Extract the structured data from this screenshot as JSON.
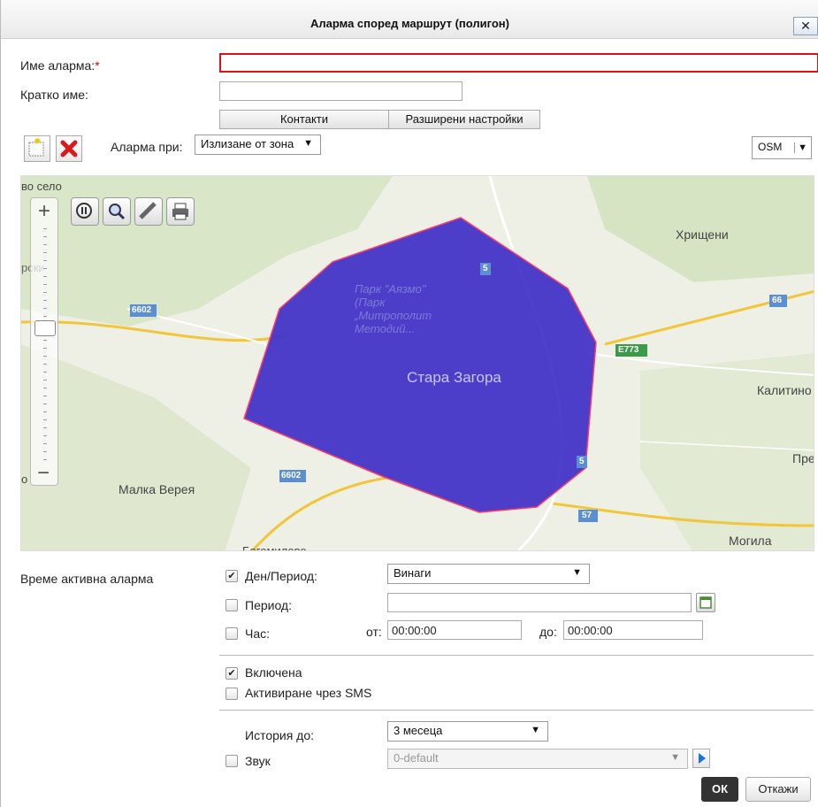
{
  "dialog": {
    "title": "Аларма според маршрут (полигон)",
    "close_label": "✕"
  },
  "form": {
    "name_label": "Име аларма:",
    "required_mark": "*",
    "name_value": "",
    "short_name_label": "Кратко име:",
    "short_name_value": "",
    "contacts_button": "Контакти",
    "advanced_button": "Разширени настройки",
    "alarm_on_label": "Аларма при:",
    "alarm_on_value": "Излизане от зона",
    "map_layer": "OSM"
  },
  "map": {
    "labels": {
      "park": "Парк \"Аязмо\"\n(Парк\n„Митрополит\nМетодий...",
      "city": "Стара Загора",
      "hristeni": "Хрищени",
      "kalitinovo": "Калитино",
      "preslaven": "Пре",
      "malka_vereya": "Малка Верея",
      "mogila": "Могила",
      "top_left": "во село",
      "left_mid": "рски",
      "left_low": "о",
      "bottom": "Богомилово",
      "road_6602_a": "6602",
      "road_6602_b": "6602",
      "road_5_a": "5",
      "road_5_b": "5",
      "road_66": "66",
      "road_e773": "E773",
      "road_57": "57"
    },
    "polygon_color": "#3f2fc8"
  },
  "schedule": {
    "section_label": "Време активна аларма",
    "day_period_label": "Ден/Период:",
    "day_period_checked": true,
    "day_period_value": "Винаги",
    "period_label": "Период:",
    "period_checked": false,
    "period_value": "",
    "hour_label": "Час:",
    "hour_checked": false,
    "from_label": "от:",
    "from_value": "00:00:00",
    "to_label": "до:",
    "to_value": "00:00:00"
  },
  "options": {
    "enabled_label": "Включена",
    "enabled_checked": true,
    "sms_label": "Активиране чрез SMS",
    "sms_checked": false
  },
  "history": {
    "label": "История до:",
    "value": "3 месеца",
    "sound_label": "Звук",
    "sound_checked": false,
    "sound_value": "0-default"
  },
  "actions": {
    "ok": "ОК",
    "cancel": "Откажи"
  },
  "checkmark": "✔"
}
